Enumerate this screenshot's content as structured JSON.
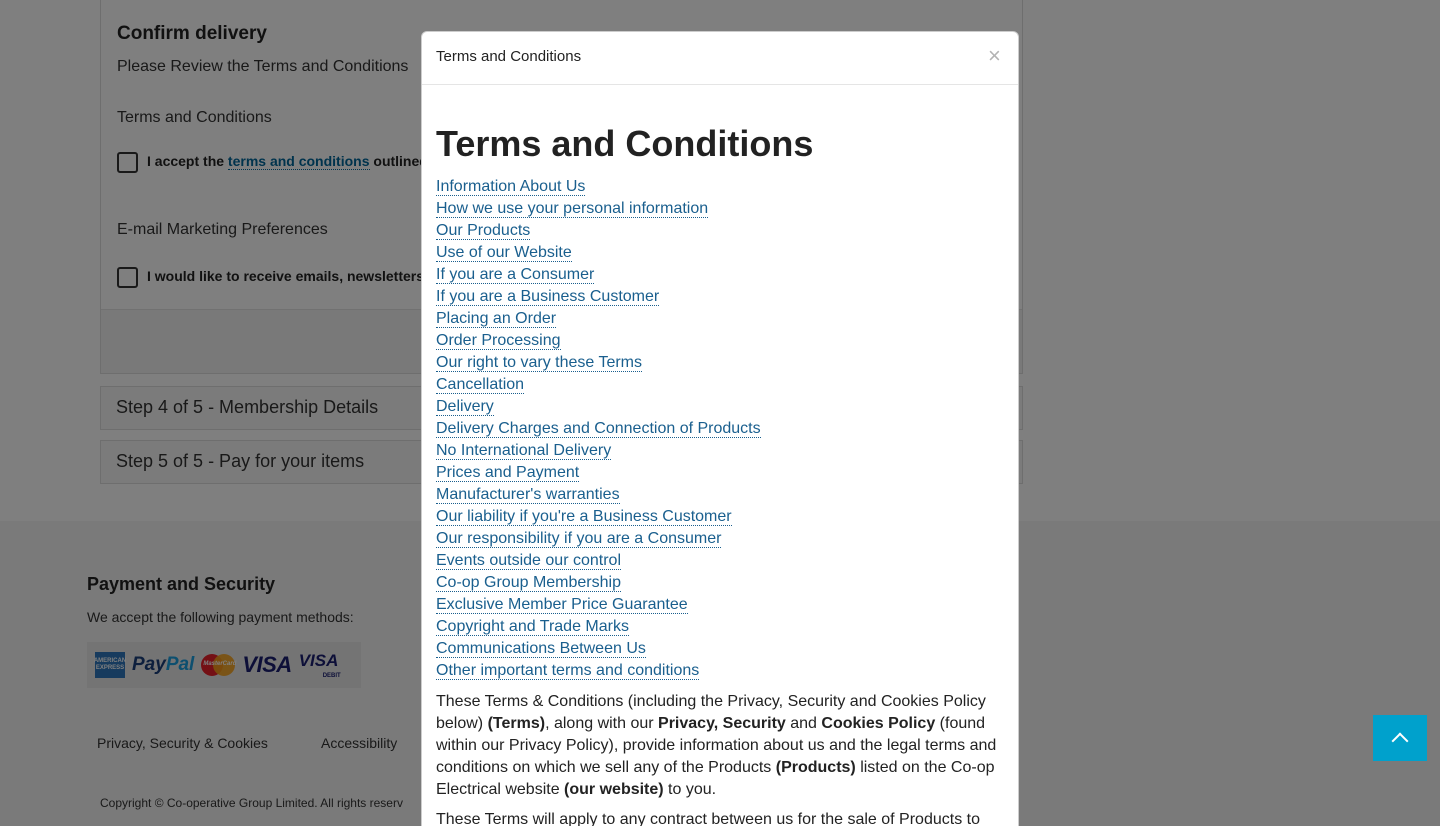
{
  "background": {
    "confirm": {
      "title": "Confirm delivery",
      "review_text": "Please Review the Terms and Conditions",
      "terms_label": "Terms and Conditions",
      "terms_check_prefix": "I accept the ",
      "terms_check_link": "terms and conditions",
      "terms_check_suffix": " outlined",
      "email_label": "E-mail Marketing Preferences",
      "email_check": "I would like to receive emails, newsletters a"
    },
    "steps": [
      {
        "label": "Step 4 of 5 - Membership Details"
      },
      {
        "label": "Step 5 of 5 - Pay for your items"
      }
    ],
    "footer": {
      "title": "Payment and Security",
      "subtitle": "We accept the following payment methods:",
      "payment_icons": [
        "amex-icon",
        "paypal-icon",
        "mastercard-icon",
        "visa-icon",
        "visa-debit-icon"
      ],
      "amex_text": "AMERICAN EXPRESS",
      "paypal_a": "Pay",
      "paypal_b": "Pal",
      "mastercard_text": "MasterCard",
      "visa_text": "VISA",
      "visa_debit_visa": "VISA",
      "visa_debit_text": "DEBIT",
      "links": [
        "Privacy, Security & Cookies",
        "Accessibility"
      ],
      "copyright": "Copyright © Co-operative Group Limited. All rights reserv"
    },
    "scroll_top_icon": "chevron-up-icon"
  },
  "modal": {
    "title": "Terms and Conditions",
    "close_symbol": "×",
    "heading": "Terms and Conditions",
    "toc": [
      "Information About Us",
      "How we use your personal information",
      "Our Products",
      "Use of our Website",
      "If you are a Consumer",
      "If you are a Business Customer",
      "Placing an Order",
      "Order Processing",
      "Our right to vary these Terms",
      "Cancellation",
      "Delivery",
      "Delivery Charges and Connection of Products",
      "No International Delivery",
      "Prices and Payment",
      "Manufacturer's warranties",
      "Our liability if you're a Business Customer",
      "Our responsibility if you are a Consumer",
      "Events outside our control",
      "Co-op Group Membership",
      "Exclusive Member Price Guarantee",
      "Copyright and Trade Marks",
      "Communications Between Us",
      "Other important terms and conditions"
    ],
    "intro": {
      "p1": "These Terms & Conditions (including the Privacy, Security and Cookies Policy below) ",
      "b1": "(Terms)",
      "p2": ", along with our ",
      "b2": "Privacy, Security",
      "p3": " and ",
      "b3": "Cookies Policy",
      "p4": " (found within our Privacy Policy), provide information about us and the legal terms and conditions on which we sell any of the Products ",
      "b4": "(Products)",
      "p5": " listed on the Co-op Electrical website ",
      "b5": "(our website)",
      "p6": " to you."
    },
    "intro2": "These Terms will apply to any contract between us for the sale of Products to"
  }
}
